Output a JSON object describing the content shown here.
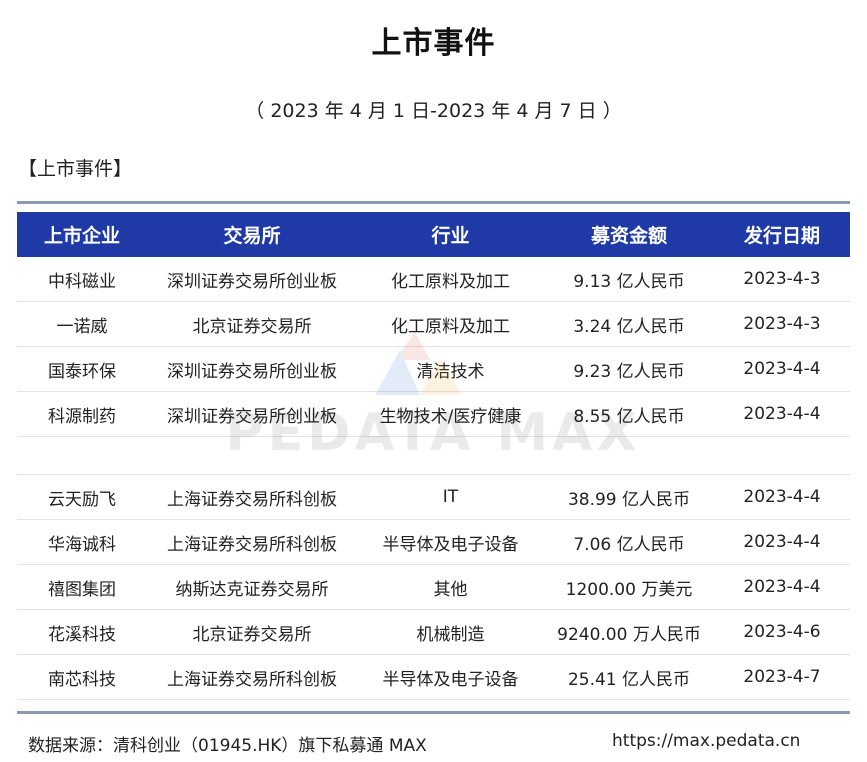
{
  "title": "上市事件",
  "date_range": "（ 2023 年 4 月 1 日-2023 年 4 月 7 日 ）",
  "section_label": "【上市事件】",
  "table": {
    "headers": [
      "上市企业",
      "交易所",
      "行业",
      "募资金额",
      "发行日期"
    ],
    "rows": [
      [
        "中科磁业",
        "深圳证券交易所创业板",
        "化工原料及加工",
        "9.13 亿人民币",
        "2023-4-3"
      ],
      [
        "一诺威",
        "北京证券交易所",
        "化工原料及加工",
        "3.24 亿人民币",
        "2023-4-3"
      ],
      [
        "国泰环保",
        "深圳证券交易所创业板",
        "清洁技术",
        "9.23 亿人民币",
        "2023-4-4"
      ],
      [
        "科源制药",
        "深圳证券交易所创业板",
        "生物技术/医疗健康",
        "8.55 亿人民币",
        "2023-4-4"
      ],
      [
        "云天励飞",
        "上海证券交易所科创板",
        "IT",
        "38.99 亿人民币",
        "2023-4-4"
      ],
      [
        "华海诚科",
        "上海证券交易所科创板",
        "半导体及电子设备",
        "7.06 亿人民币",
        "2023-4-4"
      ],
      [
        "禧图集团",
        "纳斯达克证券交易所",
        "其他",
        "1200.00 万美元",
        "2023-4-4"
      ],
      [
        "花溪科技",
        "北京证券交易所",
        "机械制造",
        "9240.00 万人民币",
        "2023-4-6"
      ],
      [
        "南芯科技",
        "上海证券交易所科创板",
        "半导体及电子设备",
        "25.41 亿人民币",
        "2023-4-7"
      ]
    ]
  },
  "watermark": "PEDATA MAX",
  "footer": {
    "source": "数据来源：清科创业（01945.HK）旗下私募通 MAX",
    "url": "https://max.pedata.cn"
  },
  "colors": {
    "header_bg": "#1f3aa6",
    "header_text": "#ffffff",
    "rule": "#8a9bb0"
  }
}
